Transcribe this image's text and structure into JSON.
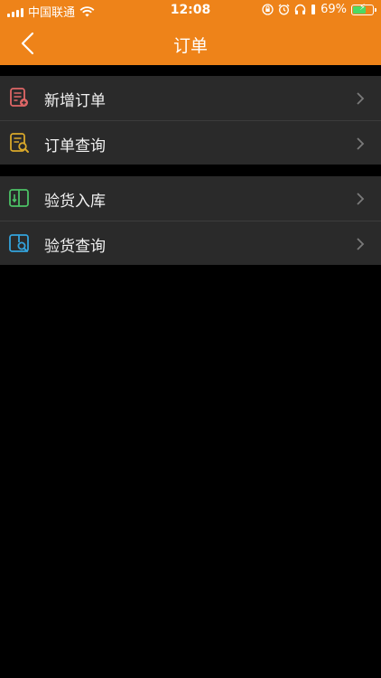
{
  "status_bar": {
    "carrier": "中国联通",
    "time": "12:08",
    "battery": "69%",
    "battery_level": 0.69
  },
  "nav": {
    "title": "订单",
    "back_icon": "chevron-left-icon"
  },
  "groups": [
    {
      "items": [
        {
          "label": "新增订单",
          "icon": "new-order-icon",
          "icon_color": "#E06767"
        },
        {
          "label": "订单查询",
          "icon": "order-search-icon",
          "icon_color": "#D9A82A"
        }
      ]
    },
    {
      "items": [
        {
          "label": "验货入库",
          "icon": "stock-in-icon",
          "icon_color": "#4CC266"
        },
        {
          "label": "验货查询",
          "icon": "inspection-search-icon",
          "icon_color": "#33A3DC"
        }
      ]
    }
  ],
  "colors": {
    "header": "#EE8319",
    "background": "#000000",
    "row": "#2A2A2A",
    "separator": "#3C3C3C",
    "chevron": "#7A7A7A"
  }
}
